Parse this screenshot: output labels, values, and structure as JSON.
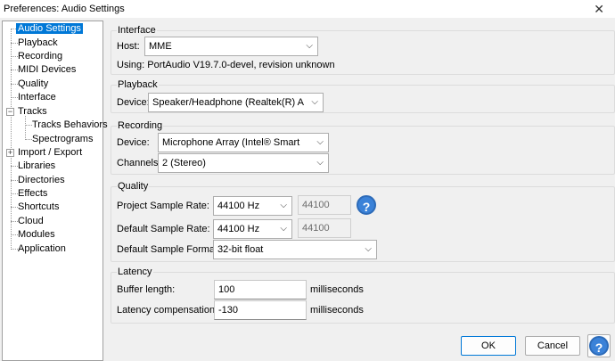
{
  "window": {
    "title": "Preferences: Audio Settings",
    "close_glyph": "✕"
  },
  "tree": {
    "items": [
      {
        "label": "Audio Settings"
      },
      {
        "label": "Playback"
      },
      {
        "label": "Recording"
      },
      {
        "label": "MIDI Devices"
      },
      {
        "label": "Quality"
      },
      {
        "label": "Interface"
      },
      {
        "label": "Tracks"
      },
      {
        "label": "Tracks Behaviors"
      },
      {
        "label": "Spectrograms"
      },
      {
        "label": "Import / Export"
      },
      {
        "label": "Libraries"
      },
      {
        "label": "Directories"
      },
      {
        "label": "Effects"
      },
      {
        "label": "Shortcuts"
      },
      {
        "label": "Cloud"
      },
      {
        "label": "Modules"
      },
      {
        "label": "Application"
      }
    ],
    "expander_minus": "−",
    "expander_plus": "+"
  },
  "interface": {
    "title": "Interface",
    "host_label": "Host:",
    "host_value": "MME",
    "using_text": "Using: PortAudio V19.7.0-devel, revision unknown"
  },
  "playback": {
    "title": "Playback",
    "device_label": "Device:",
    "device_value": "Speaker/Headphone (Realtek(R) A"
  },
  "recording": {
    "title": "Recording",
    "device_label": "Device:",
    "device_value": "Microphone Array (Intel® Smart",
    "channels_label": "Channels:",
    "channels_value": "2 (Stereo)"
  },
  "quality": {
    "title": "Quality",
    "project_rate_label": "Project Sample Rate:",
    "project_rate_value": "44100 Hz",
    "project_rate_text": "44100",
    "default_rate_label": "Default Sample Rate:",
    "default_rate_value": "44100 Hz",
    "default_rate_text": "44100",
    "format_label": "Default Sample Format:",
    "format_value": "32-bit float",
    "help_glyph": "?"
  },
  "latency": {
    "title": "Latency",
    "buffer_label": "Buffer length:",
    "buffer_value": "100",
    "buffer_unit": "milliseconds",
    "comp_label": "Latency compensation:",
    "comp_value": "-130",
    "comp_unit": "milliseconds"
  },
  "footer": {
    "ok_label": "OK",
    "cancel_label": "Cancel",
    "help_glyph": "?"
  },
  "combo_arrow": "⌵"
}
